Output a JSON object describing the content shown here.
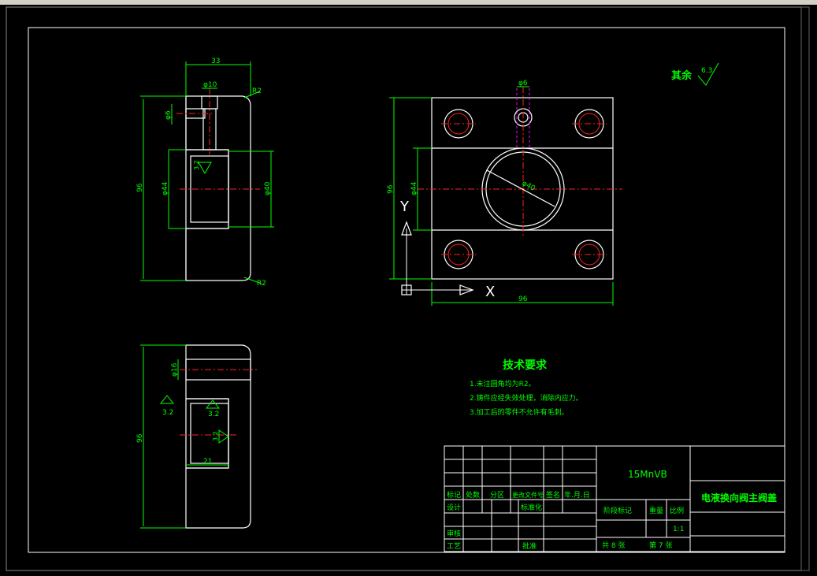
{
  "top_view": {
    "dim_width": "33",
    "dim_phi10": "φ10",
    "dim_phi6": "φ6",
    "dim_phi44": "φ44",
    "dim_phi40": "φ40",
    "dim_height": "96",
    "chamfer_top": "R2",
    "chamfer_bottom": "R2",
    "rough_inner": "3.2"
  },
  "plan_view": {
    "dim_width": "96",
    "dim_height": "96",
    "dim_phi44": "φ44",
    "dim_phi40": "φ40",
    "dim_phi6": "φ6",
    "axis_y": "Y",
    "axis_x": "X"
  },
  "section_view": {
    "dim_phi16": "φ16",
    "dim_height": "96",
    "dim_21": "21",
    "rough_a": "3.2",
    "rough_b": "3.2",
    "rough_c": "3.2"
  },
  "roughness_note": {
    "label": "其余",
    "value": "6.3"
  },
  "tech_requirements": {
    "title": "技术要求",
    "items": [
      "1.未注圆角均为R2。",
      "2.铸件应经失效处理，消除内应力。",
      "3.加工后的零件不允许有毛刺。"
    ]
  },
  "title_block": {
    "material": "15MnVB",
    "part_name": "电液换向阀主阀盖",
    "col_mark": "标记",
    "col_count": "处数",
    "col_zone": "分区",
    "col_docno": "更改文件号",
    "col_sign": "签名",
    "col_date": "年.月.日",
    "design": "设计",
    "standardize": "标准化",
    "review": "审核",
    "process": "工艺",
    "approve": "批准",
    "stage_mark": "阶段标记",
    "weight": "重量",
    "scale": "比例",
    "scale_value": "1:1",
    "sheets_total": "共 8 张",
    "sheet_no": "第 7 张"
  }
}
